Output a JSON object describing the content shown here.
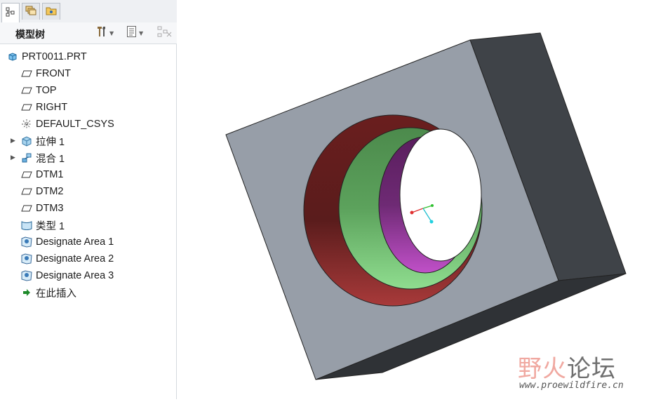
{
  "panel": {
    "title": "模型树",
    "tabs": [
      {
        "icon": "model-tree-tab-icon",
        "active": true
      },
      {
        "icon": "layers-tab-icon",
        "active": false
      },
      {
        "icon": "folder-tab-icon",
        "active": false
      }
    ],
    "toolbar": {
      "settings_icon": "tools-icon",
      "show_icon": "list-icon",
      "filter_icon": "filter-icon",
      "caret": "▼"
    }
  },
  "tree": {
    "items": [
      {
        "label": "PRT0011.PRT",
        "icon": "part-icon"
      },
      {
        "label": "FRONT",
        "icon": "datum-plane-icon"
      },
      {
        "label": "TOP",
        "icon": "datum-plane-icon"
      },
      {
        "label": "RIGHT",
        "icon": "datum-plane-icon"
      },
      {
        "label": "DEFAULT_CSYS",
        "icon": "csys-icon"
      },
      {
        "label": "拉伸 1",
        "icon": "extrude-icon",
        "expander": "▶"
      },
      {
        "label": "混合 1",
        "icon": "blend-icon",
        "expander": "▶"
      },
      {
        "label": "DTM1",
        "icon": "datum-plane-icon"
      },
      {
        "label": "DTM2",
        "icon": "datum-plane-icon"
      },
      {
        "label": "DTM3",
        "icon": "datum-plane-icon"
      },
      {
        "label": "类型 1",
        "icon": "quilt-icon"
      },
      {
        "label": "Designate Area 1",
        "icon": "designate-area-icon"
      },
      {
        "label": "Designate Area 2",
        "icon": "designate-area-icon"
      },
      {
        "label": "Designate Area 3",
        "icon": "designate-area-icon"
      },
      {
        "label": "在此插入",
        "icon": "insert-here-arrow-icon"
      }
    ]
  },
  "watermark": {
    "title_part1": "野火",
    "title_part2": "论坛",
    "url": "www.proewildfire.cn"
  },
  "colors": {
    "block_front": "#979ea8",
    "block_side": "#3f4348",
    "hole_outer": "#8a2a2a",
    "hole_middle": "#5fae5f",
    "hole_inner": "#8a2a8a"
  }
}
